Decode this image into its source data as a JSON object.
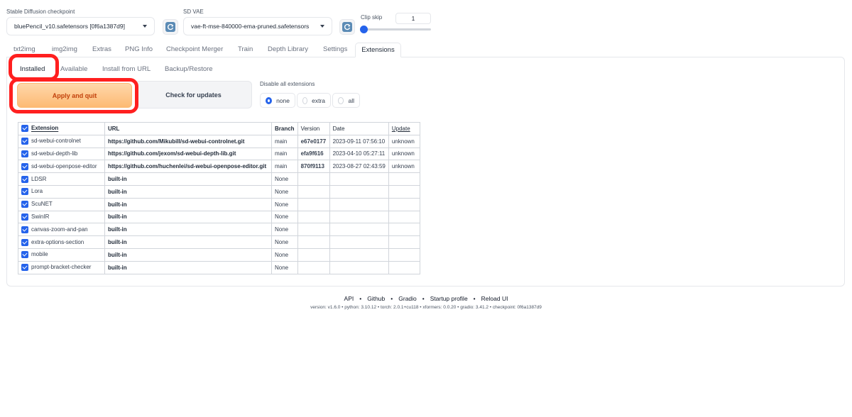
{
  "top": {
    "checkpoint_label": "Stable Diffusion checkpoint",
    "checkpoint_value": "bluePencil_v10.safetensors [0f6a1387d9]",
    "vae_label": "SD VAE",
    "vae_value": "vae-ft-mse-840000-ema-pruned.safetensors",
    "clip_skip_label": "Clip skip",
    "clip_skip_value": "1"
  },
  "tabs": [
    "txt2img",
    "img2img",
    "Extras",
    "PNG Info",
    "Checkpoint Merger",
    "Train",
    "Depth Library",
    "Settings",
    "Extensions"
  ],
  "subtabs": [
    "Installed",
    "Available",
    "Install from URL",
    "Backup/Restore"
  ],
  "buttons": {
    "apply": "Apply and quit",
    "check": "Check for updates"
  },
  "disable": {
    "label": "Disable all extensions",
    "options": [
      "none",
      "extra",
      "all"
    ],
    "selected": "none"
  },
  "table": {
    "headers": [
      "Extension",
      "URL",
      "Branch",
      "Version",
      "Date",
      "Update"
    ],
    "rows": [
      {
        "name": "sd-webui-controlnet",
        "url": "https://github.com/Mikubill/sd-webui-controlnet.git",
        "branch": "main",
        "version": "e67e0177",
        "date": "2023-09-11 07:56:10",
        "update": "unknown"
      },
      {
        "name": "sd-webui-depth-lib",
        "url": "https://github.com/jexom/sd-webui-depth-lib.git",
        "branch": "main",
        "version": "efa9f616",
        "date": "2023-04-10 05:27:11",
        "update": "unknown"
      },
      {
        "name": "sd-webui-openpose-editor",
        "url": "https://github.com/huchenlei/sd-webui-openpose-editor.git",
        "branch": "main",
        "version": "870f9113",
        "date": "2023-08-27 02:43:59",
        "update": "unknown"
      },
      {
        "name": "LDSR",
        "url": "built-in",
        "branch": "None",
        "version": "",
        "date": "",
        "update": ""
      },
      {
        "name": "Lora",
        "url": "built-in",
        "branch": "None",
        "version": "",
        "date": "",
        "update": ""
      },
      {
        "name": "ScuNET",
        "url": "built-in",
        "branch": "None",
        "version": "",
        "date": "",
        "update": ""
      },
      {
        "name": "SwinIR",
        "url": "built-in",
        "branch": "None",
        "version": "",
        "date": "",
        "update": ""
      },
      {
        "name": "canvas-zoom-and-pan",
        "url": "built-in",
        "branch": "None",
        "version": "",
        "date": "",
        "update": ""
      },
      {
        "name": "extra-options-section",
        "url": "built-in",
        "branch": "None",
        "version": "",
        "date": "",
        "update": ""
      },
      {
        "name": "mobile",
        "url": "built-in",
        "branch": "None",
        "version": "",
        "date": "",
        "update": ""
      },
      {
        "name": "prompt-bracket-checker",
        "url": "built-in",
        "branch": "None",
        "version": "",
        "date": "",
        "update": ""
      }
    ]
  },
  "footer": {
    "links": [
      "API",
      "Github",
      "Gradio",
      "Startup profile",
      "Reload UI"
    ],
    "version_text": "version: v1.6.0  •  python: 3.10.12  •  torch: 2.0.1+cu118  •  xformers: 0.0.20  •  gradio: 3.41.2  •  checkpoint: 0f6a1387d9"
  }
}
